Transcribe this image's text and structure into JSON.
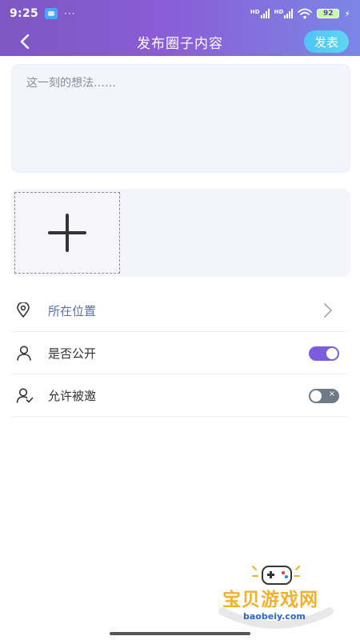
{
  "status_bar": {
    "time": "9:25",
    "dots": "···",
    "network_badge": "HD",
    "battery": "92"
  },
  "nav": {
    "back_icon": "chevron-left-icon",
    "title": "发布圈子内容",
    "publish_label": "发表"
  },
  "post": {
    "text_value": "",
    "placeholder": "这一刻的想法……"
  },
  "images": {
    "add_icon": "plus-icon",
    "count": 0
  },
  "settings": {
    "location_label": "所在位置",
    "public_label": "是否公开",
    "public_enabled": true,
    "invite_label": "允许被邀",
    "invite_enabled": false
  },
  "watermark": {
    "text": "宝贝游戏网",
    "url": "baobeiy.com"
  },
  "colors": {
    "header_start": "#7E57C2",
    "header_end": "#7B86E6",
    "publish_button": "#4FC3F7",
    "toggle_on": "#7B5CE0",
    "toggle_off": "#6E7A86",
    "location_text": "#5A6FAE"
  }
}
